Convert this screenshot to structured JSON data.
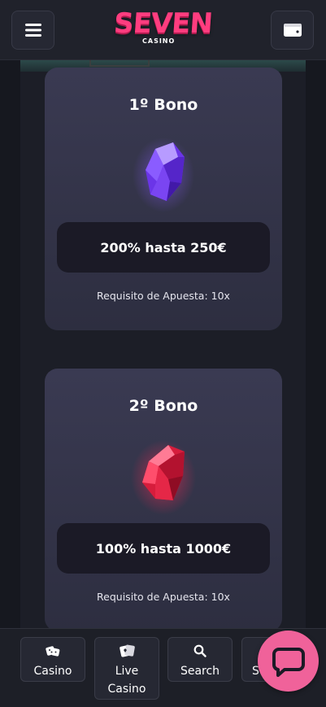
{
  "header": {
    "logo_main": "SEVEN",
    "logo_sub": "CASINO"
  },
  "bonuses": [
    {
      "title": "1º Bono",
      "amount": "200% hasta 250€",
      "requirement": "Requisito de Apuesta: 10x",
      "gem": "purple-gem-icon"
    },
    {
      "title": "2º Bono",
      "amount": "100% hasta 1000€",
      "requirement": "Requisito de Apuesta: 10x",
      "gem": "red-gem-icon"
    }
  ],
  "nav": {
    "casino": "Casino",
    "live_line1": "Live",
    "live_line2": "Casino",
    "search": "Search",
    "extra": "S"
  },
  "colors": {
    "brand": "#ff3d7f",
    "chat_button": "#f0629a",
    "card_bg": "#35354b",
    "amount_bg": "#1b1a26"
  }
}
